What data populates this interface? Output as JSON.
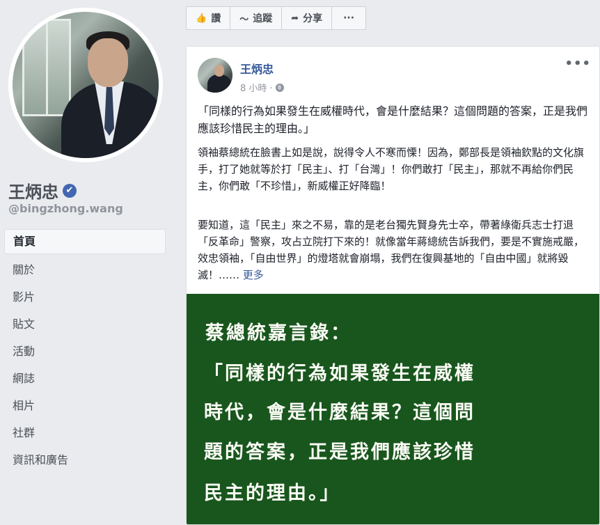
{
  "profile": {
    "name": "王炳忠",
    "verified_mark": "✔",
    "handle": "@bingzhong.wang"
  },
  "nav": {
    "items": [
      "首頁",
      "關於",
      "影片",
      "貼文",
      "活動",
      "網誌",
      "相片",
      "社群",
      "資訊和廣告"
    ]
  },
  "actions": {
    "like": {
      "icon": "thumbs-up-icon",
      "label": "讚"
    },
    "follow": {
      "icon": "rss-icon",
      "label": "追蹤"
    },
    "share": {
      "icon": "share-arrow-icon",
      "label": "分享"
    },
    "more": {
      "icon": "more-dots-icon",
      "label": "···"
    }
  },
  "post": {
    "author": "王炳忠",
    "time": "8 小時 ·",
    "more_label": "•••",
    "para1": "「同樣的行為如果發生在威權時代，會是什麼結果？這個問題的答案，正是我們應該珍惜民主的理由。」",
    "para2": "領袖蔡總統在臉書上如是說，說得令人不寒而慄！因為，鄭部長是領袖欽點的文化旗手，打了她就等於打「民主」、打「台灣」！你們敢打「民主」，那就不再給你們民主，你們敢「不珍惜」，新威權正好降臨！",
    "para3": "要知道，這「民主」來之不易，靠的是老台獨先賢身先士卒，帶著綠衛兵志士打退「反革命」警察，攻占立院打下來的！就像當年蔣總統告訴我們，要是不實施戒嚴，效忠領袖，「自由世界」的燈塔就會崩塌，我們在復興基地的「自由中國」就將毀滅！……",
    "see_more": "更多",
    "image": {
      "title": "蔡總統嘉言錄：",
      "lines": [
        "「同樣的行為如果發生在威權",
        "時代，會是什麼結果？這個問",
        "題的答案，正是我們應該珍惜",
        "民主的理由。」"
      ],
      "background": "#18561d"
    }
  }
}
